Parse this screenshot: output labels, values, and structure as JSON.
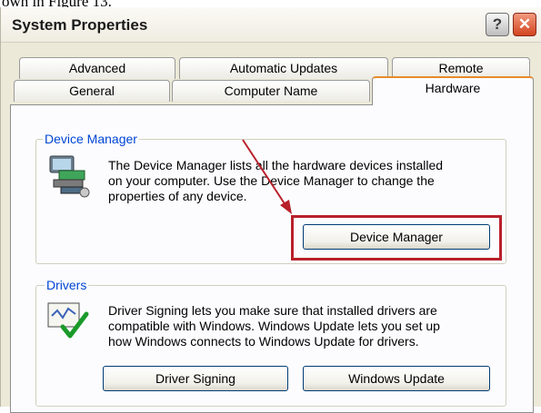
{
  "caption": "own in Figure 13.",
  "window": {
    "title": "System Properties",
    "help_label": "?",
    "close_label": "✕"
  },
  "tabs_back": [
    "Advanced",
    "Automatic Updates",
    "Remote"
  ],
  "tabs_front": [
    "General",
    "Computer Name",
    "Hardware"
  ],
  "active_tab": "Hardware",
  "device_manager": {
    "legend": "Device Manager",
    "description": [
      "The Device Manager lists all the hardware devices installed",
      "on your computer. Use the Device Manager to change the",
      "properties of any device."
    ],
    "button_label": "Device Manager",
    "icon": "hardware-devices-icon"
  },
  "drivers": {
    "legend": "Drivers",
    "description": [
      "Driver Signing lets you make sure that installed drivers are",
      "compatible with Windows. Windows Update lets you set up",
      "how Windows connects to Windows Update for drivers."
    ],
    "driver_signing_label": "Driver Signing",
    "windows_update_label": "Windows Update",
    "icon": "driver-signing-checkmark-icon"
  },
  "annotation": {
    "color": "#b8202a"
  }
}
